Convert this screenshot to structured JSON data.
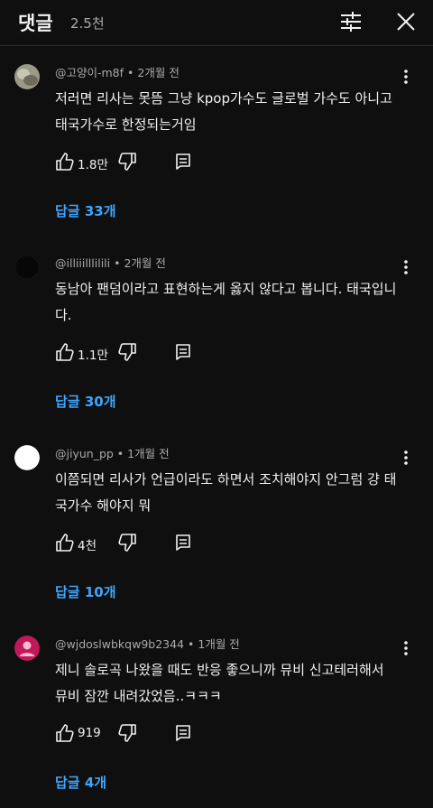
{
  "header": {
    "title": "댓글",
    "count": "2.5천"
  },
  "colors": {
    "background": "#0f0f0f",
    "text": "#f1f1f1",
    "meta": "#aaaaaa",
    "link": "#3ea6ff"
  },
  "comments": [
    {
      "author": "@고양이-m8f",
      "time": "2개월 전",
      "text": "저러면 리사는 못뜸 그냥 kpop가수도 글로벌 가수도 아니고 태국가수로 한정되는거임",
      "likes": "1.8만",
      "replies": "답글 33개",
      "avatar_icon": "cat-avatar-icon"
    },
    {
      "author": "@illiiilllilili",
      "time": "2개월 전",
      "text": "동남아 팬덤이라고 표현하는게 옳지 않다고 봅니다. 태국입니다.",
      "likes": "1.1만",
      "replies": "답글 30개",
      "avatar_icon": "dark-avatar-icon"
    },
    {
      "author": "@jiyun_pp",
      "time": "1개월 전",
      "text": "이쯤되면 리사가 언급이라도 하면서 조치해야지 안그럼 걍 태국가수 해야지 뭐",
      "likes": "4천",
      "replies": "답글 10개",
      "avatar_icon": "white-avatar-icon"
    },
    {
      "author": "@wjdoslwbkqw9b2344",
      "time": "1개월 전",
      "text": "제니 솔로곡 나왔을 때도 반응 좋으니까 뮤비 신고테러해서 뮤비 잠깐 내려갔었음..ㅋㅋㅋ",
      "likes": "919",
      "replies": "답글 4개",
      "avatar_icon": "default-person-avatar-icon"
    }
  ]
}
